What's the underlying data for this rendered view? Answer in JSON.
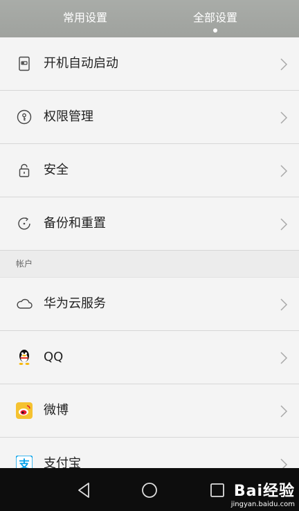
{
  "tabs": [
    {
      "label": "常用设置",
      "active": false
    },
    {
      "label": "全部设置",
      "active": true
    }
  ],
  "rows_top": [
    {
      "label": "开机自动启动",
      "icon": "power-switch-icon"
    },
    {
      "label": "权限管理",
      "icon": "permission-key-icon"
    },
    {
      "label": "安全",
      "icon": "lock-icon"
    },
    {
      "label": "备份和重置",
      "icon": "backup-reset-icon"
    }
  ],
  "section_account": {
    "label": "帐户"
  },
  "rows_account": [
    {
      "label": "华为云服务",
      "icon": "cloud-icon"
    },
    {
      "label": "QQ",
      "icon": "qq-penguin-icon"
    },
    {
      "label": "微博",
      "icon": "weibo-icon"
    },
    {
      "label": "支付宝",
      "icon": "alipay-icon"
    }
  ],
  "watermark": {
    "main": "Bai经验",
    "sub": "jingyan.baidu.com"
  },
  "colors": {
    "topbar": "#a3a6a2",
    "background": "#f4f4f4",
    "navbar": "#0d0d0d",
    "weibo": "#f5c230",
    "alipay": "#00a0e9"
  }
}
